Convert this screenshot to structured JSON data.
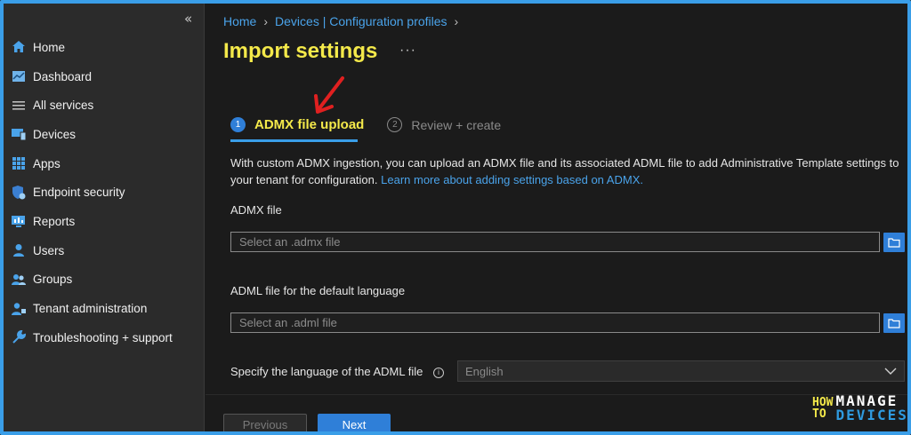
{
  "sidebar": {
    "collapse_label": "«",
    "items": [
      {
        "label": "Home",
        "icon": "home-icon"
      },
      {
        "label": "Dashboard",
        "icon": "dashboard-icon"
      },
      {
        "label": "All services",
        "icon": "list-icon"
      },
      {
        "label": "Devices",
        "icon": "devices-icon"
      },
      {
        "label": "Apps",
        "icon": "apps-grid-icon"
      },
      {
        "label": "Endpoint security",
        "icon": "shield-icon"
      },
      {
        "label": "Reports",
        "icon": "reports-icon"
      },
      {
        "label": "Users",
        "icon": "user-icon"
      },
      {
        "label": "Groups",
        "icon": "groups-icon"
      },
      {
        "label": "Tenant administration",
        "icon": "tenant-admin-icon"
      },
      {
        "label": "Troubleshooting + support",
        "icon": "wrench-icon"
      }
    ]
  },
  "breadcrumb": {
    "home": "Home",
    "devices": "Devices | Configuration profiles"
  },
  "page": {
    "title": "Import settings",
    "more": "···"
  },
  "steps": [
    {
      "number": "1",
      "label": "ADMX file upload",
      "active": true
    },
    {
      "number": "2",
      "label": "Review + create",
      "active": false
    }
  ],
  "description": {
    "text": "With custom ADMX ingestion, you can upload an ADMX file and its associated ADML file to add Administrative Template settings to your tenant for configuration.",
    "link": "Learn more about adding settings based on ADMX."
  },
  "form": {
    "admx_label": "ADMX file",
    "admx_placeholder": "Select an .admx file",
    "adml_label": "ADML file for the default language",
    "adml_placeholder": "Select an .adml file",
    "language_label": "Specify the language of the ADML file",
    "language_value": "English"
  },
  "buttons": {
    "previous": "Previous",
    "next": "Next"
  },
  "watermark": {
    "how": "HOW",
    "to": "TO",
    "manage": "MANAGE",
    "devices": "DEVICES"
  },
  "colors": {
    "accent": "#2f7fd8",
    "title_yellow": "#f4e94a",
    "link": "#4aa3ea",
    "annotation_arrow": "#e02020"
  }
}
